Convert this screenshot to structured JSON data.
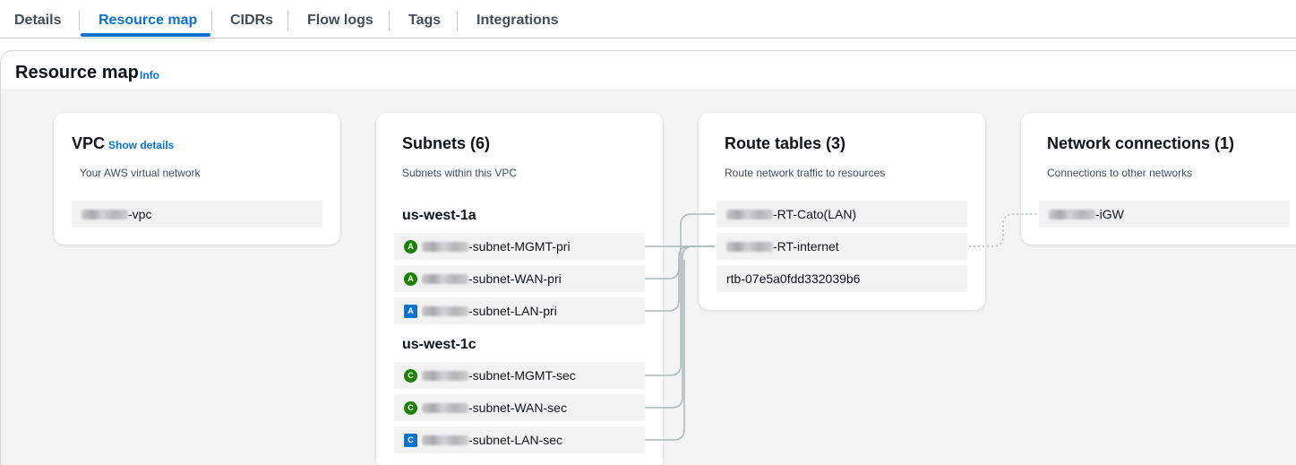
{
  "tabs": [
    {
      "label": "Details",
      "active": false
    },
    {
      "label": "Resource map",
      "active": true
    },
    {
      "label": "CIDRs",
      "active": false
    },
    {
      "label": "Flow logs",
      "active": false
    },
    {
      "label": "Tags",
      "active": false
    },
    {
      "label": "Integrations",
      "active": false
    }
  ],
  "header": {
    "title": "Resource map",
    "info": "Info"
  },
  "vpc": {
    "title": "VPC",
    "show_details": "Show details",
    "description": "Your AWS virtual network",
    "item": "-vpc"
  },
  "subnets": {
    "title": "Subnets (6)",
    "description": "Subnets within this VPC",
    "zones": [
      {
        "label": "us-west-1a",
        "items": [
          {
            "badge": "A",
            "badge_color": "#1d8102",
            "name": "-subnet-MGMT-pri"
          },
          {
            "badge": "A",
            "badge_color": "#1d8102",
            "name": "-subnet-WAN-pri"
          },
          {
            "badge": "A",
            "badge_color": "#0972d3",
            "name": "-subnet-LAN-pri"
          }
        ]
      },
      {
        "label": "us-west-1c",
        "items": [
          {
            "badge": "C",
            "badge_color": "#1d8102",
            "name": "-subnet-MGMT-sec"
          },
          {
            "badge": "C",
            "badge_color": "#1d8102",
            "name": "-subnet-WAN-sec"
          },
          {
            "badge": "C",
            "badge_color": "#0972d3",
            "name": "-subnet-LAN-sec"
          }
        ]
      }
    ]
  },
  "route_tables": {
    "title": "Route tables (3)",
    "description": "Route network traffic to resources",
    "items": [
      "-RT-Cato(LAN)",
      "-RT-internet",
      "rtb-07e5a0fdd332039b6"
    ]
  },
  "network_connections": {
    "title": "Network connections (1)",
    "description": "Connections to other networks",
    "items": [
      "-iGW"
    ]
  },
  "colors": {
    "accent": "#0972d3",
    "badge_green": "#1d8102",
    "badge_blue": "#0972d3",
    "connector": "#aab7b8"
  }
}
